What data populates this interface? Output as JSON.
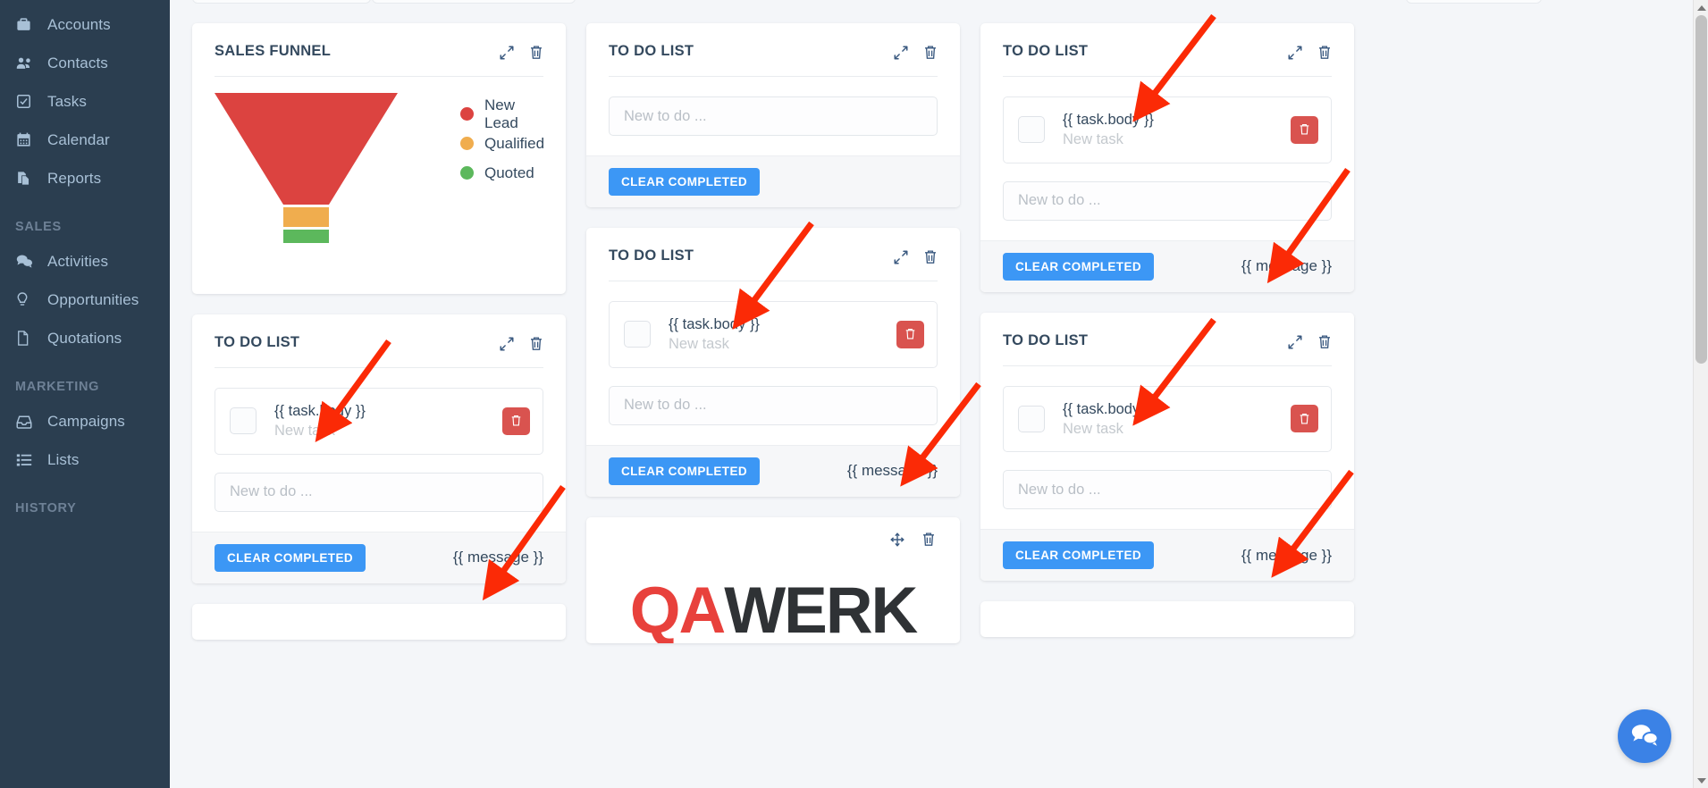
{
  "sidebar": {
    "items": [
      {
        "label": "Accounts",
        "icon": "briefcase-icon",
        "type": "link"
      },
      {
        "label": "Contacts",
        "icon": "users-icon",
        "type": "link"
      },
      {
        "label": "Tasks",
        "icon": "check-square-icon",
        "type": "link"
      },
      {
        "label": "Calendar",
        "icon": "calendar-icon",
        "type": "link"
      },
      {
        "label": "Reports",
        "icon": "report-icon",
        "type": "link"
      },
      {
        "label": "SALES",
        "icon": "",
        "type": "section"
      },
      {
        "label": "Activities",
        "icon": "comments-icon",
        "type": "link"
      },
      {
        "label": "Opportunities",
        "icon": "lightbulb-icon",
        "type": "link"
      },
      {
        "label": "Quotations",
        "icon": "file-icon",
        "type": "link"
      },
      {
        "label": "MARKETING",
        "icon": "",
        "type": "section"
      },
      {
        "label": "Campaigns",
        "icon": "inbox-icon",
        "type": "link"
      },
      {
        "label": "Lists",
        "icon": "list-icon",
        "type": "link"
      },
      {
        "label": "HISTORY",
        "icon": "",
        "type": "section"
      }
    ]
  },
  "colors": {
    "sidebar_bg": "#2b3e50",
    "accent_blue": "#3c97f5",
    "danger_red": "#d9534f",
    "new_lead": "#dc4340",
    "qualified": "#f0ad4e",
    "quoted": "#5cb85c",
    "logo_red": "#e8413c",
    "logo_dark": "#2f3235",
    "arrow_red": "#fb2a06",
    "chat_blue": "#3b82e6"
  },
  "icons": {
    "expand": "expand-arrows-icon",
    "trash": "trash-icon",
    "move": "move-arrows-icon",
    "chat": "chat-bubbles-icon"
  },
  "chart_data": {
    "type": "funnel",
    "title": "SALES FUNNEL",
    "stages": [
      {
        "label": "New Lead",
        "color": "#dc4340",
        "value": 100
      },
      {
        "label": "Qualified",
        "color": "#f0ad4e",
        "value": 18
      },
      {
        "label": "Quoted",
        "color": "#5cb85c",
        "value": 14
      }
    ],
    "legend_position": "right",
    "grid": false,
    "xlabel": "",
    "ylabel": ""
  },
  "cards": {
    "funnel": {
      "title": "SALES FUNNEL"
    },
    "todo": {
      "title": "TO DO LIST",
      "task_body": "{{ task.body }}",
      "task_sub": "New task",
      "input_placeholder": "New to do ...",
      "input_value": "",
      "clear_label": "CLEAR COMPLETED",
      "message": "{{ message }}"
    },
    "logo": {
      "qa": "QA",
      "werk": "WERK"
    }
  }
}
